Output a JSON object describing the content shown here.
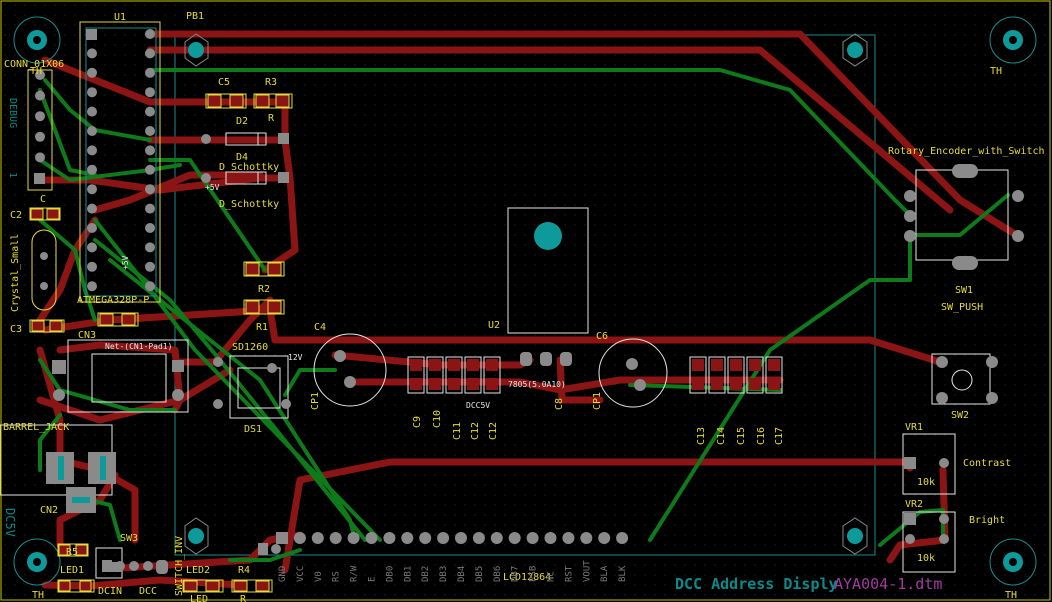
{
  "colors": {
    "background": "#000000",
    "grid": "#2a2a2a",
    "top_copper": "#8b1414",
    "bottom_copper": "#0f7a1a",
    "silkscreen": "#e6dc3c",
    "outline": "#c8c800",
    "courtyard": "#1c8c8c",
    "pad": "#8a8a8a",
    "mounting_hole": "#0e9a9a",
    "title": "#0c8a8a",
    "title_magenta": "#a23aa2"
  },
  "title": {
    "main": "DCC Address Disply",
    "magenta": "AYA004-1.dtm"
  },
  "labels": {
    "u1": "U1",
    "pb1": "PB1",
    "conn": "CONN_01X06",
    "debug": "DEBUG",
    "one": "1",
    "c2": "C2",
    "c_small": "C",
    "crystal": "Crystal_Small",
    "c3": "C3",
    "cn3": "CN3",
    "barrel": "BARREL_JACK",
    "c5": "C5",
    "r3": "R3",
    "r3v": "R",
    "d2": "D2",
    "d4": "D4",
    "ds1": "D_Schottky",
    "ds2": "D_Schottky",
    "plus5": "+5V",
    "atmega": "ATMEGA328P-P",
    "r2": "R2",
    "r1": "R1",
    "plus5v": "+5V",
    "sd": "SD1260",
    "v12": "12V",
    "ds": "DS1",
    "c4": "C4",
    "cp1a": "CP1",
    "u2": "U2",
    "u2v": "7805(5.0A10)",
    "c6": "C6",
    "cp1b": "CP1",
    "c8": "C8",
    "c9": "C9",
    "c10": "C10",
    "c11": "C11",
    "c12": "C12",
    "dcc5v": "DCC5V",
    "c13": "C13",
    "c14": "C14",
    "c15": "C15",
    "c16": "C16",
    "c17": "C17",
    "rot": "Rotary_Encoder_with_Switch",
    "sw1": "SW1",
    "swpush": "SW_PUSH",
    "sw2": "SW2",
    "vr1": "VR1",
    "contrast": "Contrast",
    "k10a": "10k",
    "vr2": "VR2",
    "bright": "Bright",
    "k10b": "10k",
    "cn2": "CN2",
    "dc5v": "DC5V",
    "r5": "R5",
    "led1": "LED1",
    "dcin": "DCIN",
    "dcc": "DCC",
    "sw3": "SW3",
    "switchinv": "SWITCH_INV",
    "led2": "LED2",
    "r4": "R4",
    "ledl": "LED",
    "rl": "R",
    "lcd": "LCD12864",
    "th": "TH",
    "net_cn": "Net-(CN1-Pad1)",
    "pad_c": "C"
  },
  "lcd_pins": [
    "GND",
    "VCC",
    "V0",
    "RS",
    "R/W",
    "E",
    "DB0",
    "DB1",
    "DB2",
    "DB3",
    "DB4",
    "DB5",
    "DB6",
    "DB7",
    "PSB",
    "NC",
    "RST",
    "VOUT",
    "BLA",
    "BLK"
  ]
}
